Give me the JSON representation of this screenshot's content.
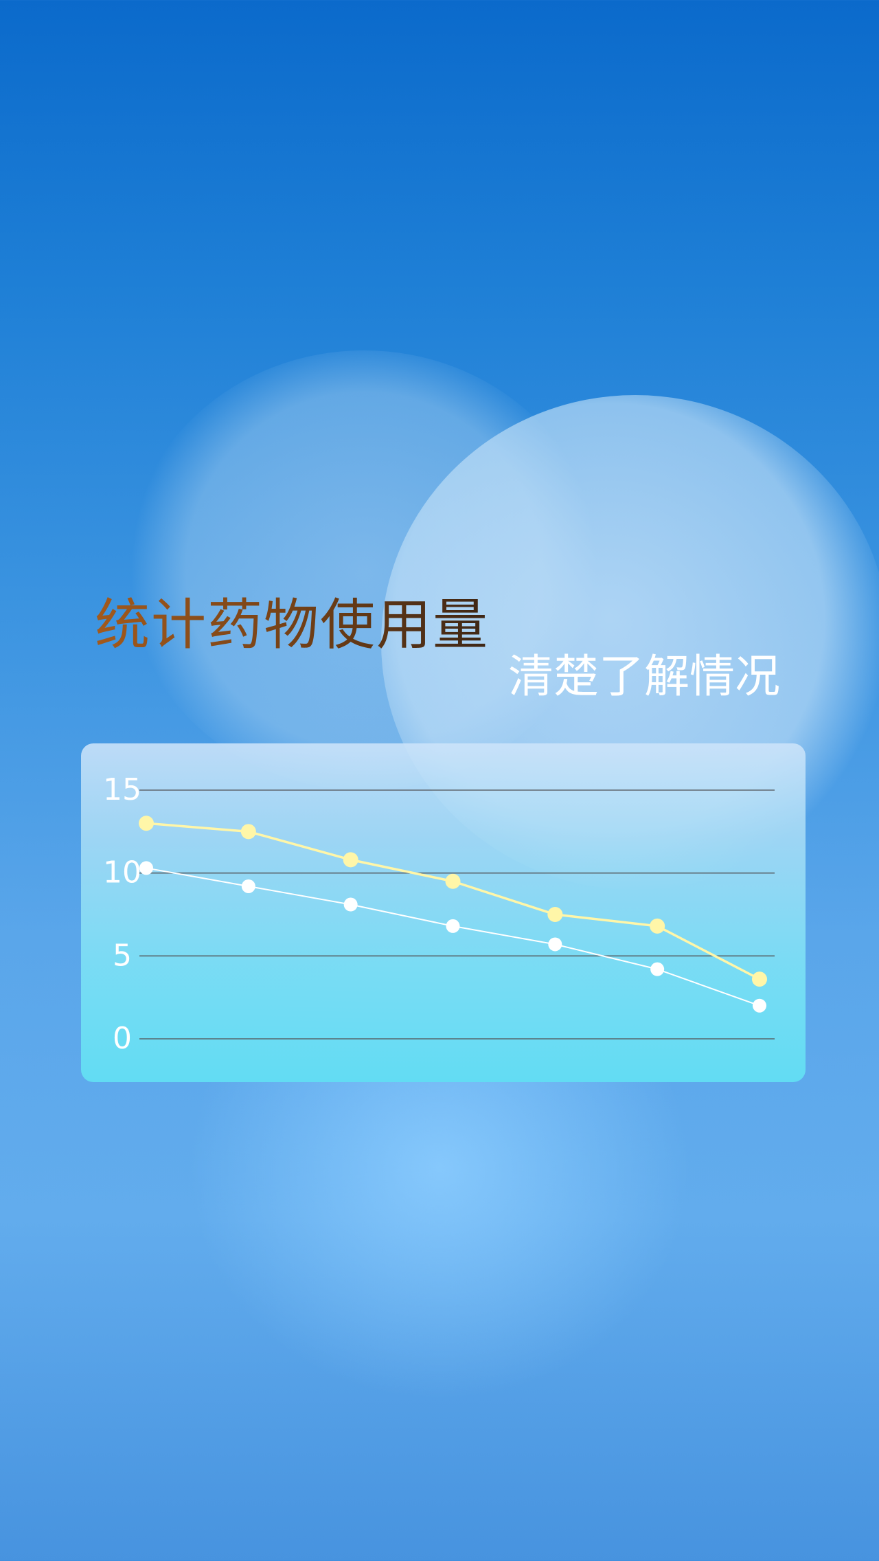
{
  "header": {
    "title": "统计药物使用量",
    "subtitle": "清楚了解情况"
  },
  "colors": {
    "series_1": "#fff6a8",
    "series_2": "#ffffff",
    "gridline": "#555a5e",
    "title_start": "#a35a1c",
    "title_end": "#3d2615"
  },
  "chart_data": {
    "type": "line",
    "title": "",
    "xlabel": "",
    "ylabel": "",
    "x": [
      1,
      2,
      3,
      4,
      5,
      6,
      7
    ],
    "ylim": [
      0,
      15
    ],
    "yticks": [
      0,
      5,
      10,
      15
    ],
    "grid": true,
    "series": [
      {
        "values": [
          13.0,
          12.5,
          10.8,
          9.5,
          7.5,
          6.8,
          3.6
        ]
      },
      {
        "values": [
          10.3,
          9.2,
          8.1,
          6.8,
          5.7,
          4.2,
          2.0
        ]
      }
    ]
  }
}
